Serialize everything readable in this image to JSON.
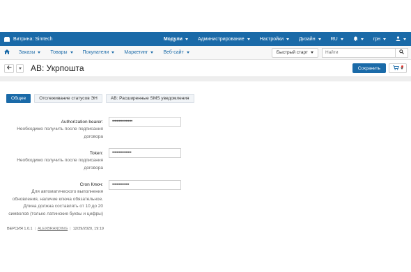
{
  "topbar": {
    "store": "Витрина: Simtech",
    "menu": [
      {
        "label": "Модули",
        "bold": true
      },
      {
        "label": "Администрирование",
        "bold": false
      },
      {
        "label": "Настройки",
        "bold": false
      },
      {
        "label": "Дизайн",
        "bold": false
      },
      {
        "label": "RU",
        "bold": false
      },
      {
        "label": "",
        "icon": "bell-icon"
      },
      {
        "label": "грн",
        "bold": false
      },
      {
        "label": "",
        "icon": "user-icon"
      }
    ]
  },
  "navbar": {
    "items": [
      "Заказы",
      "Товары",
      "Покупатели",
      "Маркетинг",
      "Веб-сайт"
    ],
    "quick_start": "Быстрый старт",
    "search_placeholder": "Найти"
  },
  "header": {
    "title": "AB: Укрпошта",
    "save_label": "Сохранить"
  },
  "tabs": [
    {
      "label": "Общее",
      "active": true
    },
    {
      "label": "Отслеживание статусов ЭН",
      "active": false
    },
    {
      "label": "AB: Расширенные SMS уведомления",
      "active": false
    }
  ],
  "fields": [
    {
      "label": "Authorization bearer:",
      "hint": [
        "Необходимо получить после подписания",
        "договора"
      ],
      "value": "••••••••••••••••••"
    },
    {
      "label": "Token:",
      "hint": [
        "Необходимо получить после подписания",
        "договора"
      ],
      "value": "•••••••••••••••••"
    },
    {
      "label": "Cron Ключ:",
      "hint": [
        "Для автоматического выполнения",
        "обновления, наличие ключа обязательное.",
        "Длина должна составлять от 10 до 20",
        "символов (только латинские буквы и цифры)"
      ],
      "value": "•••••••••••••••"
    }
  ],
  "footer": {
    "version": "ВЕРСИЯ 1.0.1",
    "vendor": "ALEXBRANDING",
    "date": "12/29/2020, 19:19"
  },
  "colors": {
    "primary": "#1a6aa8",
    "notification": "#e3342f"
  }
}
